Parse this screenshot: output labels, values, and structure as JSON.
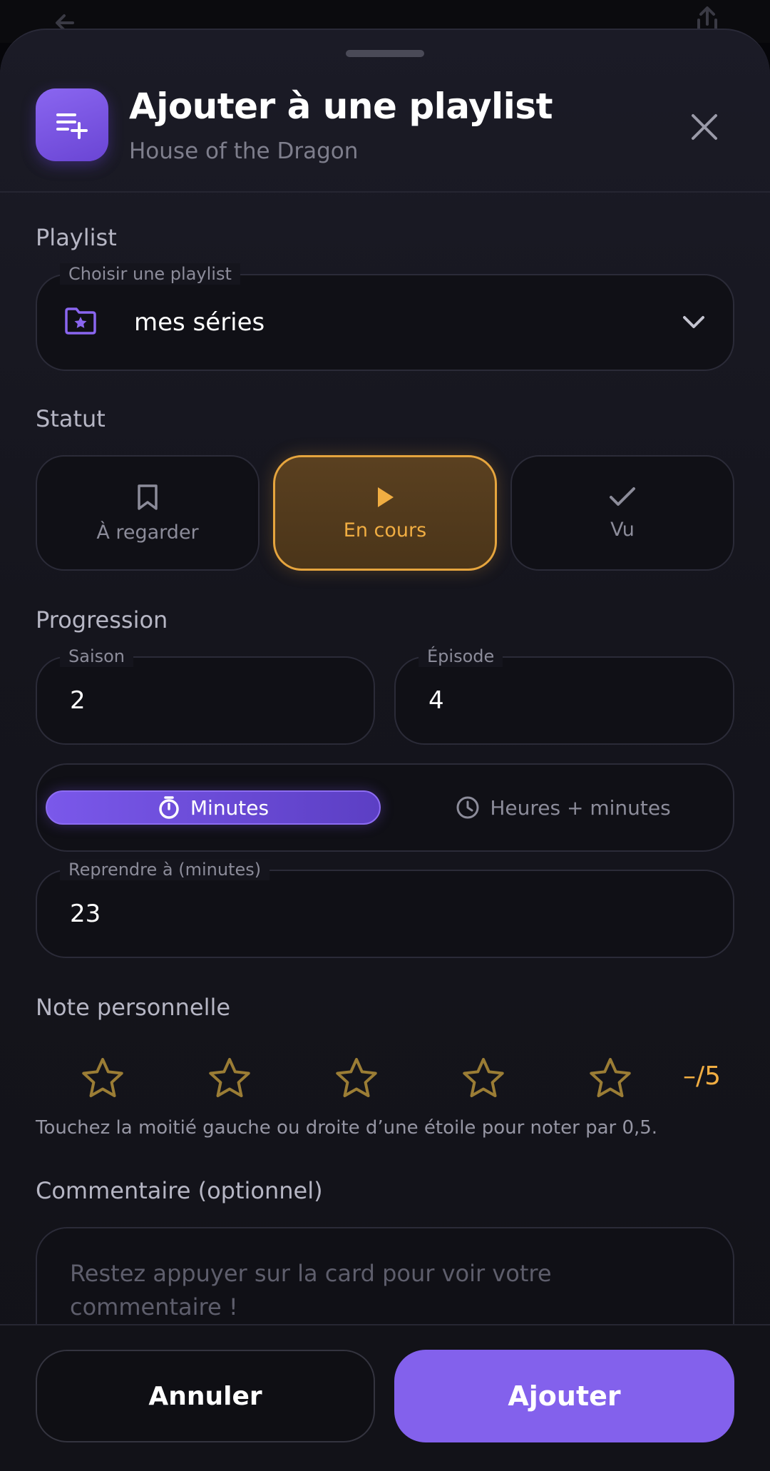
{
  "header": {
    "title": "Ajouter à une playlist",
    "subtitle": "House of the Dragon",
    "icon": "playlist-add-icon"
  },
  "playlist": {
    "section_label": "Playlist",
    "field_label": "Choisir une playlist",
    "selected": "mes séries",
    "icon": "folder-star-icon"
  },
  "status": {
    "section_label": "Statut",
    "options": [
      {
        "label": "À regarder",
        "icon": "bookmark-icon",
        "selected": false
      },
      {
        "label": "En cours",
        "icon": "play-icon",
        "selected": true
      },
      {
        "label": "Vu",
        "icon": "check-icon",
        "selected": false
      }
    ]
  },
  "progression": {
    "section_label": "Progression",
    "season_label": "Saison",
    "season_value": "2",
    "episode_label": "Épisode",
    "episode_value": "4",
    "time_modes": [
      {
        "label": "Minutes",
        "icon": "stopwatch-icon",
        "selected": true
      },
      {
        "label": "Heures + minutes",
        "icon": "clock-icon",
        "selected": false
      }
    ],
    "resume_label": "Reprendre à (minutes)",
    "resume_value": "23"
  },
  "rating": {
    "section_label": "Note personnelle",
    "stars_total": 5,
    "value_display": "–/5",
    "hint": "Touchez la moitié gauche ou droite d’une étoile pour noter par 0,5."
  },
  "comment": {
    "section_label": "Commentaire (optionnel)",
    "placeholder": "Restez appuyer sur la card pour voir votre commentaire !"
  },
  "footer": {
    "cancel_label": "Annuler",
    "add_label": "Ajouter"
  },
  "colors": {
    "accent_purple": "#8361ec",
    "accent_amber": "#f0ad42",
    "background": "#15151d"
  }
}
